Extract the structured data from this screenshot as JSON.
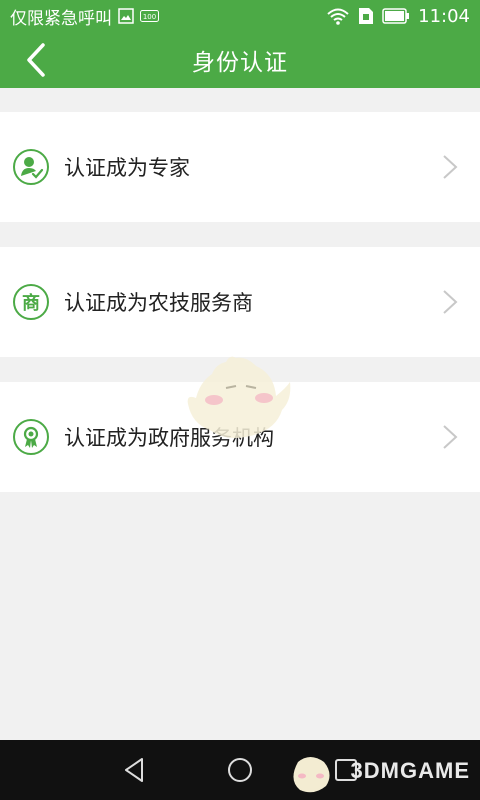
{
  "status_bar": {
    "carrier": "仅限紧急呼叫",
    "time": "11:04",
    "icons": [
      "image-icon",
      "battery-saver-icon",
      "wifi-icon",
      "sim-icon",
      "battery-icon"
    ]
  },
  "app_bar": {
    "back_icon": "chevron-left-icon",
    "title": "身份认证"
  },
  "rows": [
    {
      "label": "认证成为专家",
      "icon": "expert-user-icon"
    },
    {
      "label": "认证成为农技服务商",
      "icon": "merchant-icon",
      "icon_text": "商"
    },
    {
      "label": "认证成为政府服务机构",
      "icon": "award-icon"
    }
  ],
  "watermark": {
    "text": "3DMGAME"
  },
  "nav_bar": {
    "buttons": [
      "back-triangle-icon",
      "home-circle-icon",
      "recent-square-icon"
    ]
  },
  "colors": {
    "primary": "#4caa46",
    "background": "#f1f1f1",
    "nav": "#111111"
  }
}
